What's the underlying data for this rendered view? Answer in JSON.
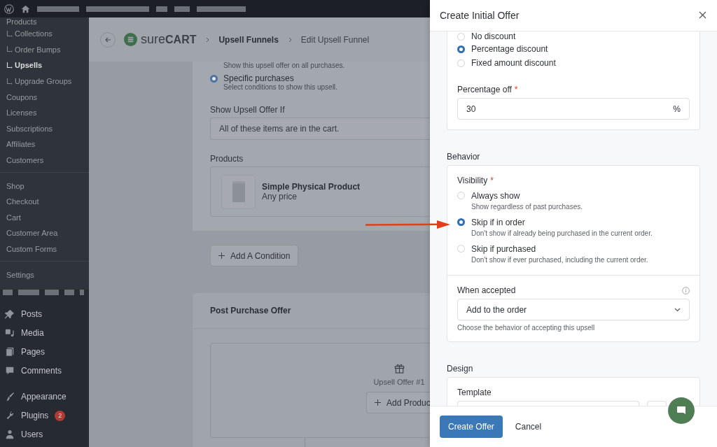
{
  "sidebar": {
    "submenu_groups": [
      [
        {
          "label": "Products",
          "kind": "top",
          "selected": false
        },
        {
          "label": "Collections",
          "kind": "child",
          "selected": false
        },
        {
          "label": "Order Bumps",
          "kind": "child",
          "selected": false
        },
        {
          "label": "Upsells",
          "kind": "child",
          "selected": true
        },
        {
          "label": "Upgrade Groups",
          "kind": "child",
          "selected": false
        },
        {
          "label": "Coupons",
          "kind": "top",
          "selected": false
        },
        {
          "label": "Licenses",
          "kind": "top",
          "selected": false
        },
        {
          "label": "Subscriptions",
          "kind": "top",
          "selected": false
        },
        {
          "label": "Affiliates",
          "kind": "top",
          "selected": false
        },
        {
          "label": "Customers",
          "kind": "top",
          "selected": false
        }
      ],
      [
        {
          "label": "Shop",
          "kind": "top",
          "selected": false
        },
        {
          "label": "Checkout",
          "kind": "top",
          "selected": false
        },
        {
          "label": "Cart",
          "kind": "top",
          "selected": false
        },
        {
          "label": "Customer Area",
          "kind": "top",
          "selected": false
        },
        {
          "label": "Custom Forms",
          "kind": "top",
          "selected": false
        }
      ],
      [
        {
          "label": "Settings",
          "kind": "top",
          "selected": false
        }
      ]
    ],
    "menu_groups": [
      [
        {
          "label": "Posts"
        },
        {
          "label": "Media"
        },
        {
          "label": "Pages"
        },
        {
          "label": "Comments"
        }
      ],
      [
        {
          "label": "Appearance"
        },
        {
          "label": "Plugins",
          "badge": "2"
        },
        {
          "label": "Users"
        }
      ]
    ]
  },
  "header": {
    "logo": {
      "light": "sure",
      "bold": "CART"
    },
    "breadcrumbs": [
      {
        "label": "Upsell Funnels",
        "current": false
      },
      {
        "label": "Edit Upsell Funnel",
        "current": true
      }
    ]
  },
  "conditions": {
    "options": [
      {
        "description": "Show this upsell offer on all purchases."
      },
      {
        "label": "Specific purchases",
        "description": "Select conditions to show this upsell.",
        "selected": true
      }
    ],
    "show_if": {
      "label": "Show Upsell Offer If",
      "value": "All of these items are in the cart."
    },
    "products": {
      "label": "Products",
      "items": [
        {
          "name": "Simple Physical Product",
          "price": "Any price"
        }
      ]
    },
    "add_condition": "Add A Condition"
  },
  "post_purchase": {
    "title": "Post Purchase Offer",
    "offer_label": "Upsell Offer #1",
    "add_button": "Add Produc"
  },
  "drawer": {
    "title": "Create Initial Offer",
    "discount_options": [
      {
        "label": "No discount",
        "selected": false
      },
      {
        "label": "Percentage discount",
        "selected": true
      },
      {
        "label": "Fixed amount discount",
        "selected": false
      }
    ],
    "percentage_off": {
      "label": "Percentage off",
      "required_mark": "*",
      "value": "30",
      "suffix": "%"
    },
    "behavior": {
      "heading": "Behavior",
      "visibility": {
        "label": "Visibility",
        "required_mark": "*",
        "options": [
          {
            "label": "Always show",
            "description": "Show regardless of past purchases.",
            "selected": false
          },
          {
            "label": "Skip if in order",
            "description": "Don't show if already being purchased in the current order.",
            "selected": true
          },
          {
            "label": "Skip if purchased",
            "description": "Don't show if ever purchased, including the current order.",
            "selected": false
          }
        ]
      },
      "when_accepted": {
        "label": "When accepted",
        "value": "Add to the order",
        "help": "Choose the behavior of accepting this upsell"
      }
    },
    "design": {
      "heading": "Design",
      "template_label": "Template"
    },
    "buttons": [
      {
        "label": "Create Offer",
        "kind": "primary"
      },
      {
        "label": "Cancel",
        "kind": "link"
      }
    ]
  }
}
